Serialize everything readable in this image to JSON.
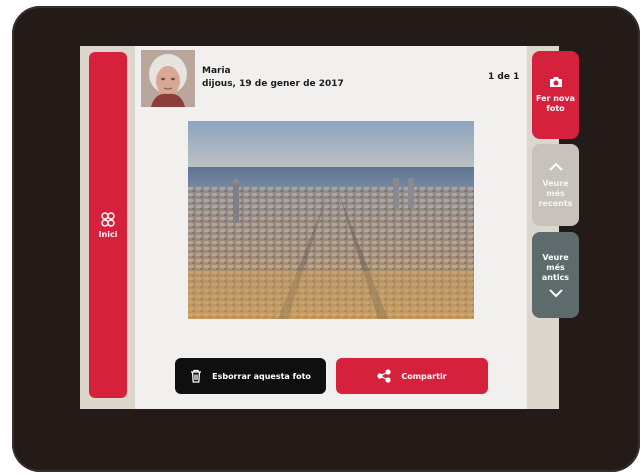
{
  "nav": {
    "home_label": "Inici"
  },
  "header": {
    "user_name": "Maria",
    "date": "dijous, 19 de gener de 2017",
    "counter": "1 de 1"
  },
  "actions": {
    "delete_label": "Esborrar aquesta foto",
    "share_label": "Compartir"
  },
  "side": {
    "new_photo_line1": "Fer nova",
    "new_photo_line2": "foto",
    "newer_line1": "Veure",
    "newer_line2": "més",
    "newer_line3": "recents",
    "older_line1": "Veure",
    "older_line2": "més",
    "older_line3": "antics"
  },
  "colors": {
    "accent": "#d6213d",
    "bezel": "#241a18",
    "older_button": "#5d6b6c",
    "newer_button_disabled": "#c8c2bc"
  },
  "icons": [
    "home-grid-icon",
    "camera-icon",
    "chevron-up-icon",
    "chevron-down-icon",
    "trash-icon",
    "share-icon"
  ]
}
